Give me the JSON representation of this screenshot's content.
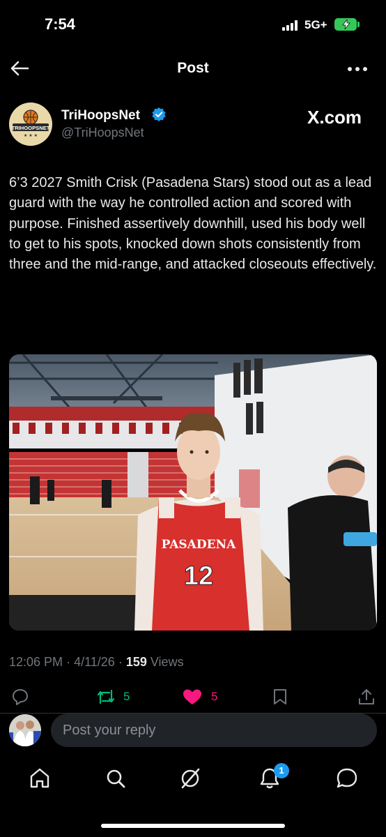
{
  "status_bar": {
    "time": "7:54",
    "network": "5G+",
    "battery_state": "charging",
    "battery_color": "#34c759"
  },
  "nav": {
    "title": "Post",
    "back_icon": "arrow-left-icon",
    "more_icon": "more-horizontal-icon"
  },
  "post": {
    "author": {
      "display_name": "TriHoopsNet",
      "handle": "@TriHoopsNet",
      "verified": true,
      "avatar_text": "TRIHOOPSNET"
    },
    "source_label": "X.com",
    "text": "6’3 2027 Smith Crisk (Pasadena Stars) stood out as a lead guard with the way he controlled action and scored with purpose. Finished assertively downhill, used his body well to get to his spots, knocked down shots consistently from three and the mid-range, and attacked closeouts effectively.",
    "image": {
      "jersey_text": "PASADENA",
      "jersey_number": "12"
    },
    "meta": {
      "time": "12:06 PM",
      "date": "4/11/26",
      "views": "159",
      "views_label": "Views"
    },
    "actions": {
      "reposts": "5",
      "likes": "5",
      "repost_color": "#00ba7c",
      "like_color": "#f91880"
    }
  },
  "reply": {
    "placeholder": "Post your reply"
  },
  "tab_bar": {
    "items": [
      "home-icon",
      "search-icon",
      "grok-icon",
      "notifications-icon",
      "messages-icon"
    ],
    "notification_badge": "1",
    "accent": "#1d9bf0"
  }
}
